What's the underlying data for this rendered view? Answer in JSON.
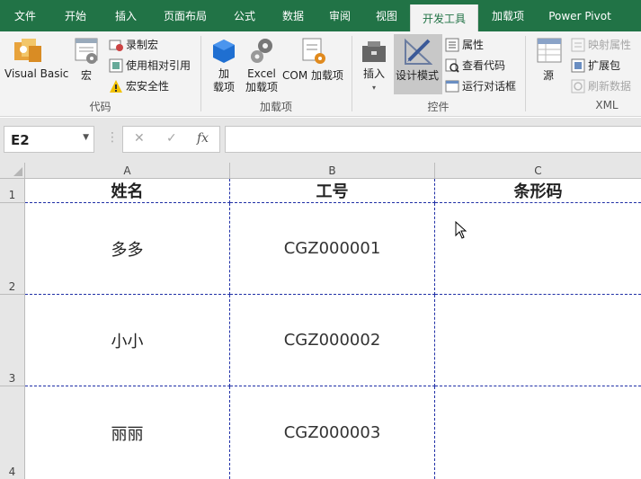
{
  "tabs": [
    {
      "label": "文件",
      "active": false
    },
    {
      "label": "开始",
      "active": false
    },
    {
      "label": "插入",
      "active": false
    },
    {
      "label": "页面布局",
      "active": false
    },
    {
      "label": "公式",
      "active": false
    },
    {
      "label": "数据",
      "active": false
    },
    {
      "label": "审阅",
      "active": false
    },
    {
      "label": "视图",
      "active": false
    },
    {
      "label": "开发工具",
      "active": true
    },
    {
      "label": "加载项",
      "active": false
    },
    {
      "label": "Power Pivot",
      "active": false
    }
  ],
  "ribbon": {
    "code_group": {
      "label": "代码",
      "visual_basic": "Visual Basic",
      "macros": "宏",
      "record_macro": "录制宏",
      "use_relative": "使用相对引用",
      "macro_security": "宏安全性"
    },
    "addins_group": {
      "label": "加载项",
      "addins_line1": "加",
      "addins_line2": "载项",
      "excel_addins_line1": "Excel",
      "excel_addins_line2": "加载项",
      "com_addins": "COM 加载项"
    },
    "controls_group": {
      "label": "控件",
      "insert": "插入",
      "design_mode": "设计模式",
      "properties": "属性",
      "view_code": "查看代码",
      "run_dialog": "运行对话框"
    },
    "xml_group": {
      "label": "XML",
      "source": "源",
      "map_properties": "映射属性",
      "expansion_packs": "扩展包",
      "refresh_data": "刷新数据"
    }
  },
  "formula_bar": {
    "name_box": "E2",
    "cancel_glyph": "✕",
    "enter_glyph": "✓",
    "fx_glyph": "fx",
    "formula": ""
  },
  "sheet": {
    "columns": [
      "A",
      "B",
      "C"
    ],
    "rows": [
      "1",
      "2",
      "3",
      "4"
    ],
    "header_row": [
      "姓名",
      "工号",
      "条形码"
    ],
    "data": [
      [
        "多多",
        "CGZ000001",
        ""
      ],
      [
        "小小",
        "CGZ000002",
        ""
      ],
      [
        "丽丽",
        "CGZ000003",
        ""
      ]
    ]
  },
  "colors": {
    "ribbon_green": "#217346",
    "page_break": "#1f2fa6"
  }
}
